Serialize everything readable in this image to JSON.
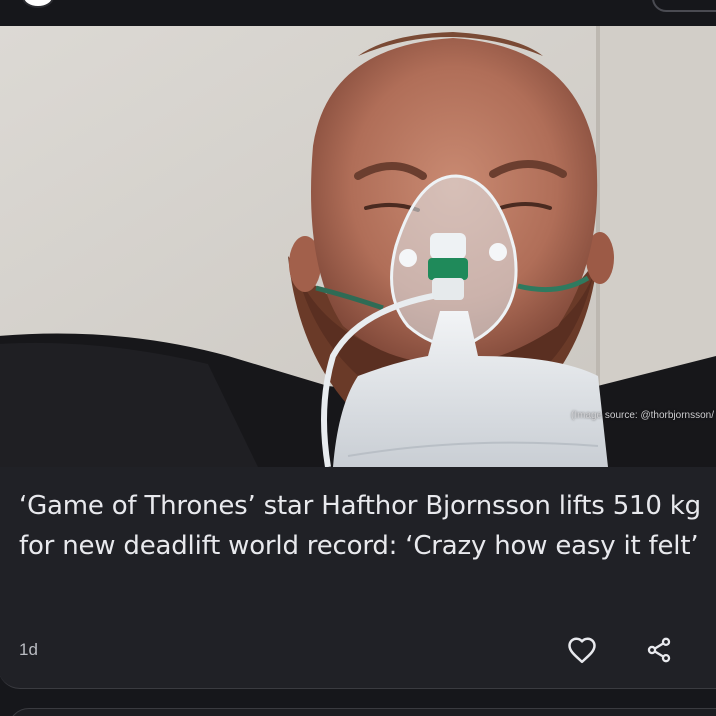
{
  "news_card": {
    "image": {
      "credit": "(Image source: @thorbjornsson/",
      "description_icon": "photo"
    },
    "headline": "‘Game of Thrones’ star Hafthor Bjornsson lifts 510 kg for new deadlift world record: ‘Crazy how easy it felt’",
    "time_ago": "1d",
    "actions": {
      "like_icon": "heart-outline",
      "share_icon": "share"
    }
  },
  "colors": {
    "background": "#16171b",
    "card": "#202126",
    "headline_text": "#e8e9ed",
    "muted_text": "#b9bbc1"
  }
}
